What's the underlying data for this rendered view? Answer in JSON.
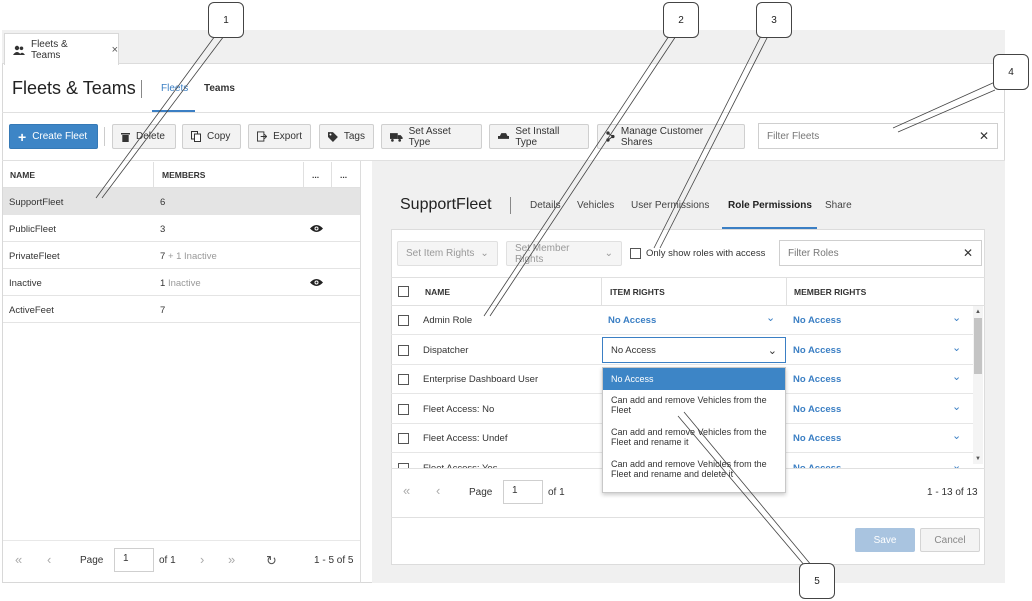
{
  "app_tab": {
    "title": "Fleets & Teams",
    "icon": "people-icon",
    "close": "×"
  },
  "header": {
    "title": "Fleets & Teams",
    "tabs": [
      {
        "label": "Fleets",
        "active": true
      },
      {
        "label": "Teams",
        "active": false
      }
    ]
  },
  "toolbar": {
    "create": "Create Fleet",
    "delete": "Delete",
    "copy": "Copy",
    "export": "Export",
    "tags": "Tags",
    "set_asset_type": "Set Asset Type",
    "set_install_type": "Set Install Type",
    "manage_shares": "Manage Customer Shares",
    "filter_placeholder": "Filter Fleets",
    "clear": "✕"
  },
  "fleet_table": {
    "columns": {
      "name": "NAME",
      "members": "MEMBERS",
      "more1": "...",
      "more2": "..."
    },
    "rows": [
      {
        "name": "SupportFleet",
        "members": "6",
        "inactive": "",
        "eye": false,
        "selected": true
      },
      {
        "name": "PublicFleet",
        "members": "3",
        "inactive": "",
        "eye": true,
        "selected": false
      },
      {
        "name": "PrivateFleet",
        "members": "7",
        "inactive": "+ 1 Inactive",
        "eye": false,
        "selected": false
      },
      {
        "name": "Inactive",
        "members": "1",
        "inactive": "Inactive",
        "eye": true,
        "selected": false
      },
      {
        "name": "ActiveFeet",
        "members": "7",
        "inactive": "",
        "eye": false,
        "selected": false
      }
    ]
  },
  "left_pager": {
    "page_label": "Page",
    "page_value": "1",
    "of": "of 1",
    "range": "1 - 5 of 5"
  },
  "detail": {
    "title": "SupportFleet",
    "tabs": [
      {
        "label": "Details",
        "active": false
      },
      {
        "label": "Vehicles",
        "active": false
      },
      {
        "label": "User Permissions",
        "active": false
      },
      {
        "label": "Role Permissions",
        "active": true
      },
      {
        "label": "Share",
        "active": false
      }
    ],
    "set_item_rights": "Set Item Rights",
    "set_member_rights": "Set Member Rights",
    "only_show_roles": "Only show roles with access",
    "filter_roles_placeholder": "Filter Roles",
    "clear": "✕"
  },
  "roles_table": {
    "columns": {
      "name": "NAME",
      "item_rights": "ITEM RIGHTS",
      "member_rights": "MEMBER RIGHTS"
    },
    "rows": [
      {
        "name": "Admin Role",
        "item": "No Access",
        "member": "No Access"
      },
      {
        "name": "Dispatcher",
        "item": "No Access",
        "member": "No Access"
      },
      {
        "name": "Enterprise Dashboard User",
        "item": "",
        "member": "No Access"
      },
      {
        "name": "Fleet Access: No",
        "item": "",
        "member": "No Access"
      },
      {
        "name": "Fleet Access: Undef",
        "item": "",
        "member": "No Access"
      },
      {
        "name": "Fleet Access: Yes",
        "item": "",
        "member": "No Access"
      }
    ]
  },
  "dropdown": {
    "options": [
      "No Access",
      "Can add and remove Vehicles from the Fleet",
      "Can add and remove Vehicles from the Fleet and rename it",
      "Can add and remove Vehicles from the Fleet and rename and delete it"
    ]
  },
  "right_pager": {
    "page_label": "Page",
    "page_value": "1",
    "of": "of 1",
    "range": "1 - 13 of 13"
  },
  "footer": {
    "save": "Save",
    "cancel": "Cancel"
  },
  "callouts": [
    "1",
    "2",
    "3",
    "4",
    "5"
  ],
  "colors": {
    "accent": "#3b7fc4",
    "primary_button": "#3d85c6",
    "selected_option": "#3d85c6",
    "save_disabled": "#a9c4e0"
  }
}
